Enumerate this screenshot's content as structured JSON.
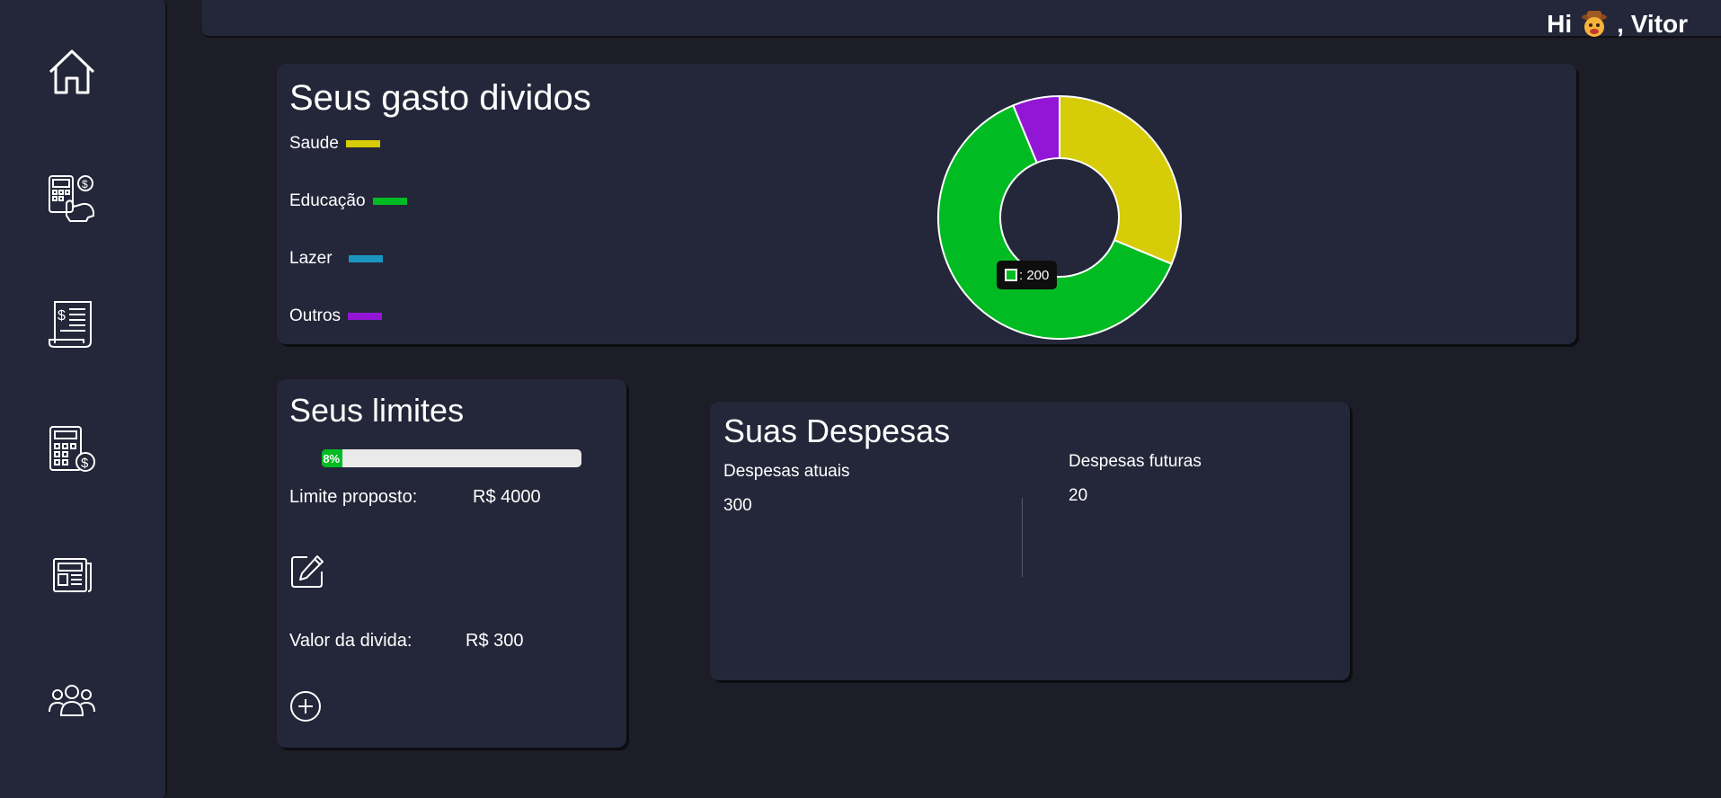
{
  "header": {
    "greeting_prefix": "Hi",
    "greeting_name": ", Vitor",
    "avatar_icon": "cowboy-emoji-icon"
  },
  "sidebar": {
    "items": [
      {
        "icon": "home-icon"
      },
      {
        "icon": "calculator-piggy-bank-icon"
      },
      {
        "icon": "invoice-receipt-icon"
      },
      {
        "icon": "calculator-dollar-icon"
      },
      {
        "icon": "newspaper-icon"
      },
      {
        "icon": "users-group-icon"
      }
    ]
  },
  "expenses_chart": {
    "title": "Seus gasto dividos",
    "legend": [
      {
        "label": "Saude",
        "color": "#d6cc08"
      },
      {
        "label": "Educação",
        "color": "#00bb22"
      },
      {
        "label": "Lazer",
        "color": "#1a95c0"
      },
      {
        "label": "Outros",
        "color": "#9316d6"
      }
    ],
    "tooltip": {
      "value": "200",
      "text": ": 200"
    }
  },
  "chart_data": {
    "type": "pie",
    "categories": [
      "Saude",
      "Educação",
      "Lazer",
      "Outros"
    ],
    "values": [
      100,
      200,
      0,
      20
    ],
    "colors": [
      "#d6cc08",
      "#00bb22",
      "#1a95c0",
      "#9316d6"
    ],
    "title": "Seus gasto dividos",
    "donut": true,
    "legend": "left"
  },
  "limits": {
    "title": "Seus limites",
    "progress": 0.08,
    "progress_label": "8%",
    "proposed_label": "Limite proposto:",
    "proposed_value": "R$ 4000",
    "debt_label": "Valor da divida:",
    "debt_value": "R$ 300",
    "edit_icon": "edit-icon",
    "add_icon": "add-circle-icon"
  },
  "despesas": {
    "title": "Suas Despesas",
    "current_label": "Despesas atuais",
    "current_value": "300",
    "future_label": "Despesas futuras",
    "future_value": "20"
  }
}
